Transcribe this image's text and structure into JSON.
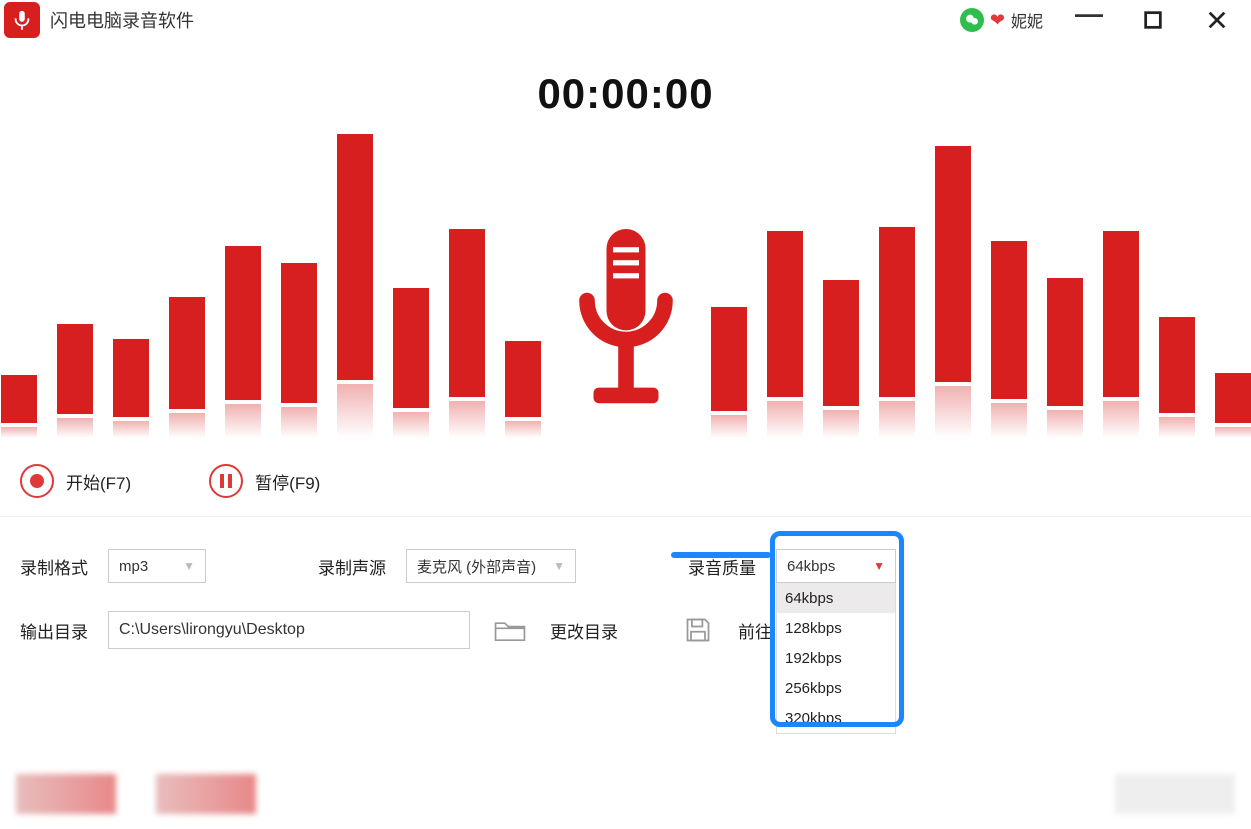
{
  "titlebar": {
    "app_name": "闪电电脑录音软件",
    "user_name": "妮妮"
  },
  "timer": "00:00:00",
  "controls": {
    "start_label": "开始(F7)",
    "pause_label": "暂停(F9)"
  },
  "settings": {
    "format_label": "录制格式",
    "format_value": "mp3",
    "source_label": "录制声源",
    "source_value": "麦克风 (外部声音)",
    "quality_label": "录音质量",
    "quality_value": "64kbps",
    "quality_options": [
      "64kbps",
      "128kbps",
      "192kbps",
      "256kbps",
      "320kbps"
    ],
    "output_label": "输出目录",
    "output_path": "C:\\Users\\lirongyu\\Desktop",
    "change_dir_label": "更改目录",
    "goto_label": "前往"
  },
  "waveform": {
    "left_bars": [
      48,
      90,
      78,
      112,
      154,
      140,
      246,
      120,
      168,
      76
    ],
    "right_bars": [
      104,
      166,
      126,
      170,
      236,
      158,
      128,
      166,
      96,
      50
    ]
  }
}
